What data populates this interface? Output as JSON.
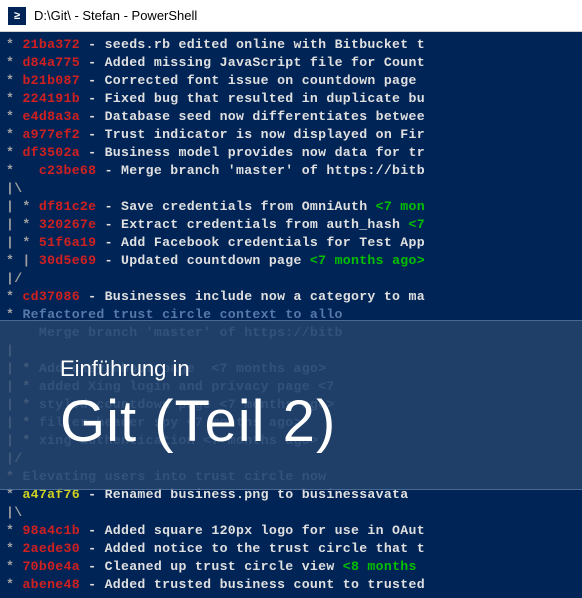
{
  "window": {
    "title": "D:\\Git\\ - Stefan - PowerShell",
    "icon_glyph": "≥"
  },
  "overlay": {
    "subtitle": "Einführung in",
    "title": "Git (Teil 2)"
  },
  "log": [
    {
      "graph": "* ",
      "hash": "21ba372",
      "hashcls": "hash-r",
      "msg": "seeds.rb edited online with Bitbucket t"
    },
    {
      "graph": "* ",
      "hash": "d84a775",
      "hashcls": "hash-r",
      "msg": "Added missing JavaScript file for Count"
    },
    {
      "graph": "* ",
      "hash": "b21b087",
      "hashcls": "hash-r",
      "msg": "Corrected font issue on countdown page "
    },
    {
      "graph": "* ",
      "hash": "224191b",
      "hashcls": "hash-r",
      "msg": "Fixed bug that resulted in duplicate bu"
    },
    {
      "graph": "* ",
      "hash": "e4d8a3a",
      "hashcls": "hash-r",
      "msg": "Database seed now differentiates betwee"
    },
    {
      "graph": "* ",
      "hash": "a977ef2",
      "hashcls": "hash-r",
      "msg": "Trust indicator is now displayed on Fir"
    },
    {
      "graph": "* ",
      "hash": "df3502a",
      "hashcls": "hash-r",
      "msg": "Business model provides now data for tr"
    },
    {
      "graph": "*   ",
      "hash": "c23be68",
      "hashcls": "hash-r",
      "msg": "Merge branch 'master' of https://bitb"
    },
    {
      "graph": "|\\  ",
      "hash": "",
      "hashcls": "",
      "msg": ""
    },
    {
      "graph": "| * ",
      "hash": "df81c2e",
      "hashcls": "hash-r",
      "msg": "Save credentials from OmniAuth",
      "age": "<7 mon"
    },
    {
      "graph": "| * ",
      "hash": "320267e",
      "hashcls": "hash-r",
      "msg": "Extract credentials from auth_hash",
      "age": "<7"
    },
    {
      "graph": "| * ",
      "hash": "51f6a19",
      "hashcls": "hash-r",
      "msg": "Add Facebook credentials for Test App"
    },
    {
      "graph": "* | ",
      "hash": "30d5e69",
      "hashcls": "hash-r",
      "msg": "Updated countdown page",
      "age": "<7 months ago>"
    },
    {
      "graph": "|/  ",
      "hash": "",
      "hashcls": "",
      "msg": ""
    },
    {
      "graph": "* ",
      "hash": "cd37086",
      "hashcls": "hash-r",
      "msg": "Businesses include now a category to ma"
    },
    {
      "graph": "* ",
      "hash": "",
      "hashcls": "",
      "msg": "Refactored trust circle context to allo",
      "dim": true
    },
    {
      "graph": "    ",
      "hash": "",
      "hashcls": "",
      "msg": "Merge branch 'master' of https://bitb",
      "dim": true
    },
    {
      "graph": "|   ",
      "hash": "",
      "hashcls": "",
      "msg": "",
      "dim": true
    },
    {
      "graph": "| * ",
      "hash": "",
      "hashcls": "",
      "msg": "Add easy about page  <7 months ago>",
      "dim": true
    },
    {
      "graph": "| * ",
      "hash": "",
      "hashcls": "",
      "msg": "added Xing login and privacy page <7",
      "dim": true
    },
    {
      "graph": "| * ",
      "hash": "",
      "hashcls": "",
      "msg": "styled countdown page <7 months ago>",
      "dim": true
    },
    {
      "graph": "| * ",
      "hash": "",
      "hashcls": "",
      "msg": "filter header spy <7 months ago>",
      "dim": true
    },
    {
      "graph": "| * ",
      "hash": "",
      "hashcls": "",
      "msg": "xing authentication <7 months ago>",
      "dim": true
    },
    {
      "graph": "|/  ",
      "hash": "",
      "hashcls": "",
      "msg": "",
      "dim": true
    },
    {
      "graph": "* ",
      "hash": "",
      "hashcls": "",
      "msg": "Elevating users into trust circle now",
      "dim": true
    },
    {
      "graph": "* ",
      "hash": "a47af76",
      "hashcls": "hash-y",
      "msg": "Renamed business.png to businessavata"
    },
    {
      "graph": "|\\  ",
      "hash": "",
      "hashcls": "",
      "msg": ""
    },
    {
      "graph": "* ",
      "hash": "98a4c1b",
      "hashcls": "hash-r",
      "msg": "Added square 120px logo for use in OAut"
    },
    {
      "graph": "* ",
      "hash": "2aede30",
      "hashcls": "hash-r",
      "msg": "Added notice to the trust circle that t"
    },
    {
      "graph": "* ",
      "hash": "70b0e4a",
      "hashcls": "hash-r",
      "msg": "Cleaned up trust circle view",
      "age": "<8 months "
    },
    {
      "graph": "* ",
      "hash": "abene48",
      "hashcls": "hash-r",
      "msg": "Added trusted business count to trusted"
    }
  ]
}
